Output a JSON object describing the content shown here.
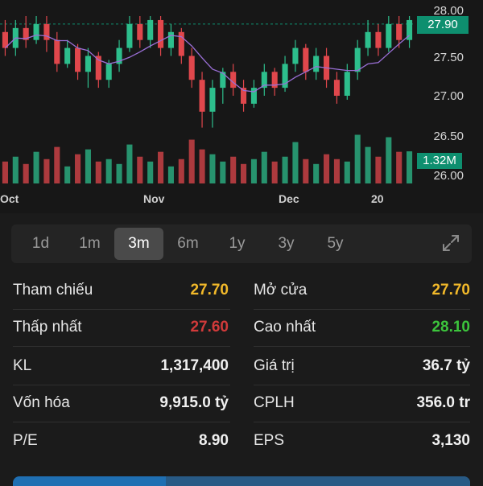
{
  "colors": {
    "up": "#2dbe8c",
    "down": "#e0474c",
    "ref": "#f2b92a",
    "low": "#d13a3a",
    "high": "#3cc43c",
    "accent_badge": "#0e8f6f"
  },
  "chart": {
    "price_ticks": [
      "28.00",
      "27.50",
      "27.00",
      "26.50",
      "26.00"
    ],
    "current_price": "27.90",
    "volume_badge": "1.32M",
    "months": [
      "Oct",
      "Nov",
      "Dec",
      "20"
    ]
  },
  "chart_data": {
    "type": "candlestick",
    "ylim": [
      26.0,
      28.0
    ],
    "candles": [
      [
        27.8,
        27.6,
        27.95,
        27.5
      ],
      [
        27.6,
        27.85,
        27.95,
        27.5
      ],
      [
        27.85,
        27.7,
        28.0,
        27.6
      ],
      [
        27.7,
        27.9,
        28.0,
        27.65
      ],
      [
        27.9,
        27.7,
        28.0,
        27.55
      ],
      [
        27.7,
        27.4,
        27.8,
        27.3
      ],
      [
        27.4,
        27.6,
        27.7,
        27.35
      ],
      [
        27.6,
        27.3,
        27.65,
        27.2
      ],
      [
        27.3,
        27.5,
        27.6,
        27.1
      ],
      [
        27.5,
        27.2,
        27.55,
        27.1
      ],
      [
        27.2,
        27.4,
        27.45,
        27.1
      ],
      [
        27.4,
        27.6,
        27.7,
        27.3
      ],
      [
        27.6,
        27.9,
        28.0,
        27.55
      ],
      [
        27.9,
        27.7,
        28.0,
        27.6
      ],
      [
        27.7,
        27.95,
        28.0,
        27.6
      ],
      [
        27.95,
        27.6,
        28.0,
        27.5
      ],
      [
        27.6,
        27.8,
        27.9,
        27.5
      ],
      [
        27.8,
        27.5,
        27.85,
        27.4
      ],
      [
        27.5,
        27.2,
        27.6,
        27.1
      ],
      [
        27.2,
        26.8,
        27.3,
        26.6
      ],
      [
        26.8,
        27.1,
        27.2,
        26.6
      ],
      [
        27.1,
        27.3,
        27.35,
        26.9
      ],
      [
        27.3,
        27.1,
        27.4,
        27.0
      ],
      [
        27.1,
        26.9,
        27.2,
        26.8
      ],
      [
        26.9,
        27.1,
        27.2,
        26.85
      ],
      [
        27.1,
        27.3,
        27.4,
        27.0
      ],
      [
        27.3,
        27.1,
        27.35,
        27.0
      ],
      [
        27.1,
        27.4,
        27.5,
        27.05
      ],
      [
        27.4,
        27.6,
        27.7,
        27.3
      ],
      [
        27.6,
        27.3,
        27.65,
        27.2
      ],
      [
        27.3,
        27.5,
        27.6,
        27.2
      ],
      [
        27.5,
        27.2,
        27.6,
        27.1
      ],
      [
        27.2,
        27.0,
        27.3,
        26.9
      ],
      [
        27.0,
        27.3,
        27.4,
        26.95
      ],
      [
        27.3,
        27.6,
        27.7,
        27.2
      ],
      [
        27.6,
        27.8,
        27.95,
        27.5
      ],
      [
        27.8,
        27.6,
        27.9,
        27.5
      ],
      [
        27.6,
        27.9,
        28.0,
        27.55
      ],
      [
        27.9,
        27.7,
        28.0,
        27.6
      ],
      [
        27.7,
        27.95,
        28.0,
        27.6
      ]
    ],
    "volumes": [
      0.9,
      1.1,
      0.8,
      1.3,
      1.0,
      1.5,
      0.7,
      1.2,
      1.4,
      0.9,
      1.0,
      0.8,
      1.6,
      1.1,
      0.9,
      1.3,
      0.7,
      1.0,
      1.8,
      1.4,
      1.2,
      0.9,
      1.1,
      0.8,
      1.0,
      1.3,
      0.9,
      1.1,
      1.7,
      1.0,
      0.8,
      1.2,
      1.0,
      0.9,
      2.0,
      1.5,
      1.1,
      1.9,
      1.3,
      1.32
    ]
  },
  "ranges": [
    "1d",
    "1m",
    "3m",
    "6m",
    "1y",
    "3y",
    "5y"
  ],
  "active_range": "3m",
  "stats": {
    "tham_chieu_label": "Tham chiếu",
    "tham_chieu_value": "27.70",
    "mo_cua_label": "Mở cửa",
    "mo_cua_value": "27.70",
    "thap_nhat_label": "Thấp nhất",
    "thap_nhat_value": "27.60",
    "cao_nhat_label": "Cao nhất",
    "cao_nhat_value": "28.10",
    "kl_label": "KL",
    "kl_value": "1,317,400",
    "gia_tri_label": "Giá trị",
    "gia_tri_value": "36.7 tỷ",
    "von_hoa_label": "Vốn hóa",
    "von_hoa_value": "9,915.0 tỷ",
    "cplh_label": "CPLH",
    "cplh_value": "356.0 tr",
    "pe_label": "P/E",
    "pe_value": "8.90",
    "eps_label": "EPS",
    "eps_value": "3,130"
  },
  "icons": {
    "expand": "expand-icon"
  }
}
